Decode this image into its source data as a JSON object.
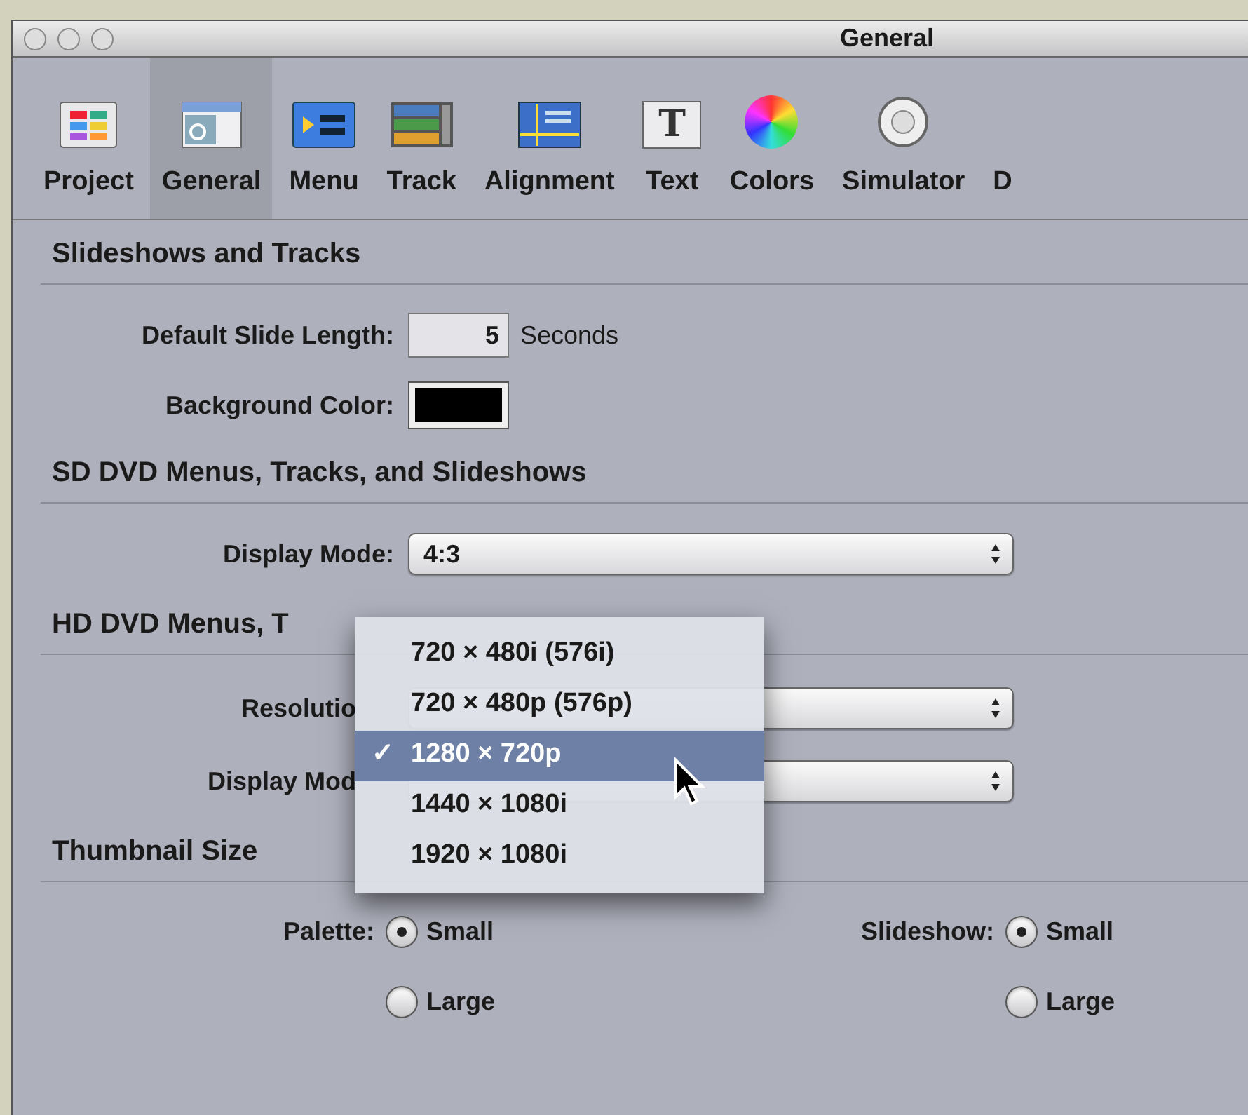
{
  "window": {
    "title": "General"
  },
  "toolbar": [
    {
      "label": "Project",
      "kind": "project",
      "selected": false
    },
    {
      "label": "General",
      "kind": "general",
      "selected": true
    },
    {
      "label": "Menu",
      "kind": "menu",
      "selected": false
    },
    {
      "label": "Track",
      "kind": "track",
      "selected": false
    },
    {
      "label": "Alignment",
      "kind": "alignment",
      "selected": false
    },
    {
      "label": "Text",
      "kind": "text",
      "selected": false,
      "glyph": "T"
    },
    {
      "label": "Colors",
      "kind": "colors",
      "selected": false
    },
    {
      "label": "Simulator",
      "kind": "simulator",
      "selected": false
    },
    {
      "label": "D",
      "kind": "partial",
      "selected": false
    }
  ],
  "slideshows": {
    "title": "Slideshows and Tracks",
    "slide_length": {
      "label": "Default Slide Length:",
      "value": "5",
      "unit": "Seconds"
    },
    "background": {
      "label": "Background Color:",
      "color": "#000000"
    }
  },
  "sd": {
    "title": "SD DVD Menus, Tracks, and Slideshows",
    "display_mode": {
      "label": "Display Mode:",
      "value": "4:3"
    }
  },
  "hd": {
    "title": "HD DVD Menus, T",
    "resolution": {
      "label": "Resolutio"
    },
    "display_mode": {
      "label": "Display Mod"
    }
  },
  "resolution_menu": [
    {
      "label": "720 × 480i (576i)",
      "selected": false
    },
    {
      "label": "720 × 480p (576p)",
      "selected": false
    },
    {
      "label": "1280 × 720p",
      "selected": true,
      "check": "✓"
    },
    {
      "label": "1440 × 1080i",
      "selected": false
    },
    {
      "label": "1920 × 1080i",
      "selected": false
    }
  ],
  "thumbnail": {
    "title": "Thumbnail Size",
    "groups": [
      {
        "label": "Palette:",
        "options": [
          {
            "label": "Small",
            "selected": true
          },
          {
            "label": "Large",
            "selected": false
          }
        ]
      },
      {
        "label": "Slideshow:",
        "options": [
          {
            "label": "Small",
            "selected": true
          },
          {
            "label": "Large",
            "selected": false
          }
        ]
      }
    ]
  }
}
